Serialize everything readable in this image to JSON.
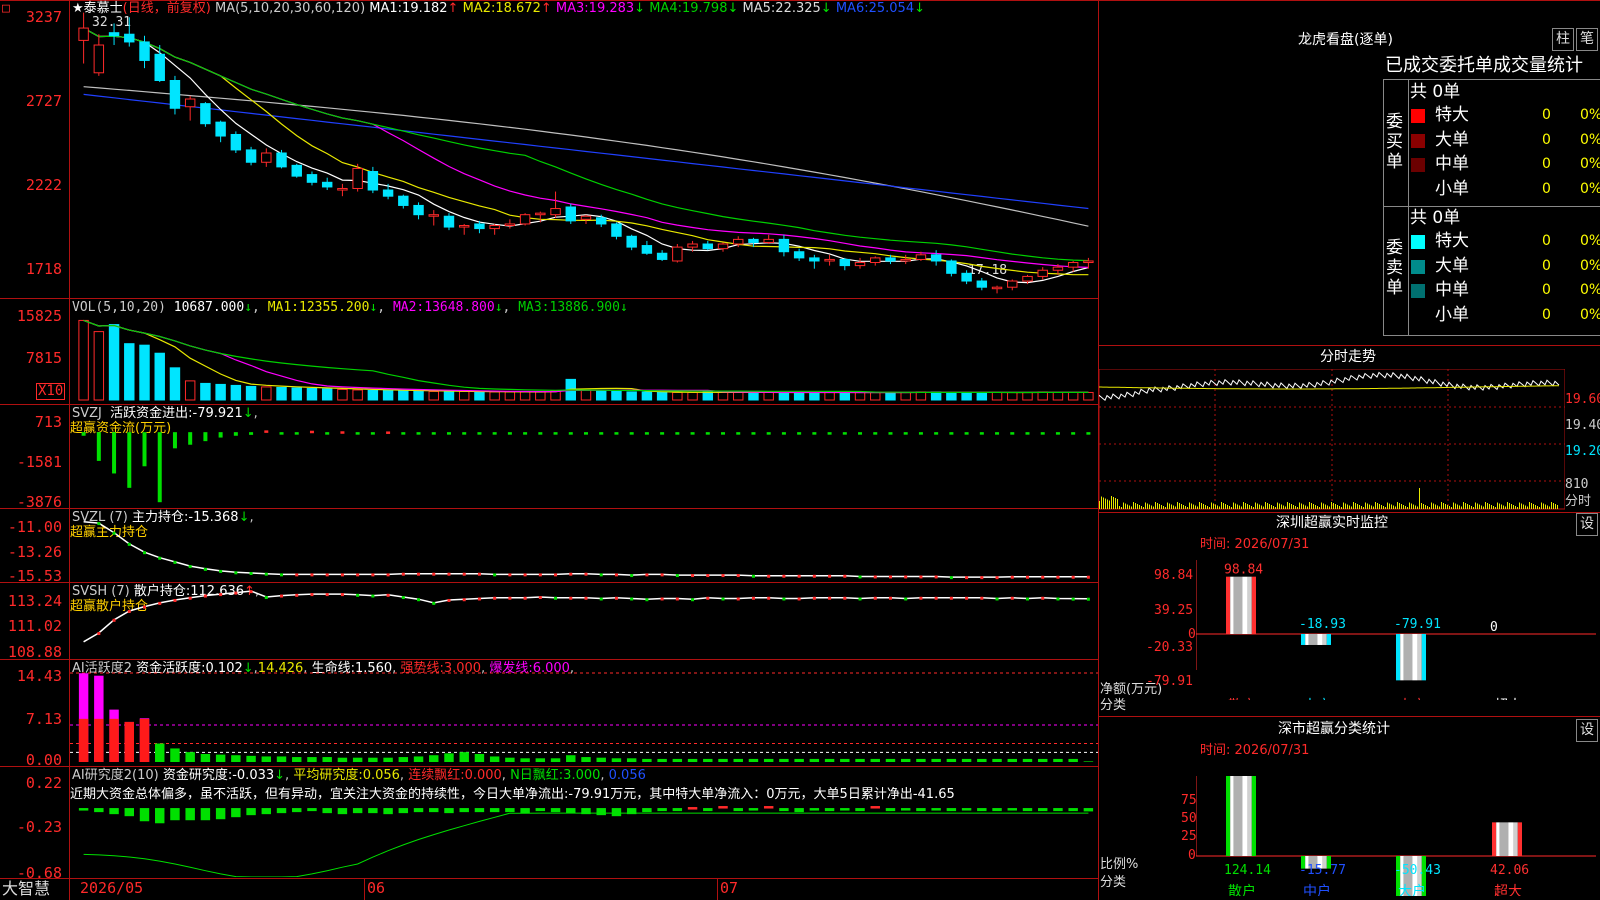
{
  "colors": {
    "up": "#ff2a2a",
    "down": "#00e5ff",
    "grid": "#b01010",
    "ma1": "#ffffff",
    "ma2": "#e8e800",
    "ma3": "#ff00ff",
    "ma4": "#00d000",
    "ma5": "#c0c0c0",
    "ma6": "#2040ff"
  },
  "main": {
    "stock_name": "泰慕士",
    "period": "(日线，前复权)",
    "ma_label": "MA(5,10,20,30,60,120)",
    "ma_values": [
      {
        "name": "MA1:",
        "value": "19.182",
        "arrow": "↑"
      },
      {
        "name": "MA2:",
        "value": "18.672",
        "arrow": "↑"
      },
      {
        "name": "MA3:",
        "value": "19.283",
        "arrow": "↓"
      },
      {
        "name": "MA4:",
        "value": "19.798",
        "arrow": "↓"
      },
      {
        "name": "MA5:",
        "value": "22.325",
        "arrow": "↓"
      },
      {
        "name": "MA6:",
        "value": "25.054",
        "arrow": "↓"
      }
    ],
    "y_ticks": [
      "3237",
      "2727",
      "2222",
      "1718"
    ],
    "high_label": "32.31",
    "low_label": "17.18",
    "corner_mark": "□"
  },
  "vol": {
    "label": "VOL(5,10,20)",
    "value": "10687.000",
    "arrow": "↓",
    "mas": [
      {
        "name": "MA1:",
        "value": "12355.200",
        "arrow": "↓"
      },
      {
        "name": "MA2:",
        "value": "13648.800",
        "arrow": "↓"
      },
      {
        "name": "MA3:",
        "value": "13886.900",
        "arrow": "↓"
      }
    ],
    "y_ticks": [
      "15825",
      "7815"
    ],
    "unit": "X10"
  },
  "svzj": {
    "label": "SVZJ",
    "name": "活跃资金进出:",
    "value": "-79.921",
    "arrow": "↓",
    "subtitle": "超赢资金流(万元)",
    "y_ticks": [
      "713",
      "-1581",
      "-3876"
    ]
  },
  "svzl": {
    "label": "SVZL (7)",
    "name": "主力持仓:",
    "value": "-15.368",
    "arrow": "↓",
    "subtitle": "超赢主力持仓",
    "y_ticks": [
      "-11.00",
      "-13.26",
      "-15.53"
    ]
  },
  "svsh": {
    "label": "SVSH (7)",
    "name": "散户持仓:",
    "value": "112.636",
    "arrow": "↑",
    "subtitle": "超赢散户持仓",
    "y_ticks": [
      "113.24",
      "111.02",
      "108.88"
    ]
  },
  "ai1": {
    "label": "AI活跃度2",
    "name": "资金活跃度:",
    "value": "0.102",
    "arrow": "↓",
    "v2": "14.426",
    "l3": "生命线:",
    "v3": "1.560",
    "l4": "强势线:",
    "v4": "3.000",
    "l5": "爆发线:",
    "v5": "6.000",
    "y_ticks": [
      "14.43",
      "7.13",
      "0.00"
    ]
  },
  "ai2": {
    "label": "AI研究度2(10)",
    "name": "资金研究度:",
    "value": "-0.033",
    "arrow": "↓",
    "l2": "平均研究度:",
    "v2": "0.056",
    "l3": "连续飘红:",
    "v3": "0.000",
    "l4": "N日飘红:",
    "v4": "3.000",
    "v5": "0.056",
    "comment": "近期大资金总体偏多，虽不活跃，但有异动，宜关注大资金的持续性，今日大单净流出:-79.91万元，其中特大单净流入：0万元，大单5日累计净出-41.65",
    "y_ticks": [
      "0.22",
      "-0.23",
      "-0.68"
    ]
  },
  "xaxis": {
    "brand": "大智慧",
    "labels": [
      "2026/05",
      "06",
      "07"
    ]
  },
  "lhb": {
    "title": "龙虎看盘(逐单)",
    "btn1": "柱",
    "btn2": "笔",
    "subtitle": "已成交委托单成交量统计",
    "buy": {
      "side": "委买单",
      "total": "共 0单",
      "rows": [
        {
          "name": "特大",
          "count": "0",
          "pct": "0%",
          "color": "#ff0000"
        },
        {
          "name": "大单",
          "count": "0",
          "pct": "0%",
          "color": "#8b0000"
        },
        {
          "name": "中单",
          "count": "0",
          "pct": "0%",
          "color": "#6b0000"
        },
        {
          "name": "小单",
          "count": "0",
          "pct": "0%",
          "color": ""
        }
      ]
    },
    "sell": {
      "side": "委卖单",
      "total": "共 0单",
      "rows": [
        {
          "name": "特大",
          "count": "0",
          "pct": "0%",
          "color": "#00ffff"
        },
        {
          "name": "大单",
          "count": "0",
          "pct": "0%",
          "color": "#008b8b"
        },
        {
          "name": "中单",
          "count": "0",
          "pct": "0%",
          "color": "#007070"
        },
        {
          "name": "小单",
          "count": "0",
          "pct": "0%",
          "color": ""
        }
      ]
    }
  },
  "intraday": {
    "title": "分时走势",
    "y_ticks": [
      "19.60",
      "19.40",
      "19.20"
    ],
    "vol_tick": "810",
    "label": "分时"
  },
  "monitor": {
    "title": "深圳超赢实时监控",
    "btn": "设",
    "time": "时间: 2026/07/31",
    "y_ticks": [
      "98.84",
      "39.25",
      "0",
      "-20.33",
      "-79.91"
    ],
    "ylabel": "净额(万元)",
    "xlabel": "分类",
    "bars": [
      {
        "cat": "散户",
        "value": 98.84,
        "label": "98.84"
      },
      {
        "cat": "中户",
        "value": -18.93,
        "label": "-18.93"
      },
      {
        "cat": "大户",
        "value": -79.91,
        "label": "-79.91"
      },
      {
        "cat": "超大",
        "value": 0,
        "label": "0"
      }
    ]
  },
  "stats": {
    "title": "深市超赢分类统计",
    "btn": "设",
    "time": "时间: 2026/07/31",
    "y_ticks": [
      "75",
      "50",
      "25",
      "0"
    ],
    "ylabel": "比例%",
    "xlabel": "分类",
    "bars": [
      {
        "cat": "散户",
        "value": 124.14,
        "label": "124.14"
      },
      {
        "cat": "中户",
        "value": -15.77,
        "label": "-15.77"
      },
      {
        "cat": "大户",
        "value": -50.43,
        "label": "-50.43"
      },
      {
        "cat": "超大",
        "value": 42.06,
        "label": "42.06"
      }
    ]
  },
  "chart_data": [
    {
      "type": "candlestick",
      "ylim": [
        17.18,
        32.31
      ],
      "y_ticks": [
        "3237",
        "2727",
        "2222",
        "1718"
      ],
      "ohlc": [
        [
          30.5,
          32.3,
          29.0,
          31.3
        ],
        [
          28.4,
          30.9,
          28.2,
          30.2
        ],
        [
          31.0,
          31.6,
          30.2,
          30.8
        ],
        [
          30.9,
          32.0,
          30.1,
          30.4
        ],
        [
          30.4,
          30.8,
          28.7,
          29.2
        ],
        [
          29.6,
          30.2,
          27.8,
          27.9
        ],
        [
          27.9,
          28.2,
          25.7,
          26.1
        ],
        [
          26.2,
          26.9,
          25.3,
          26.7
        ],
        [
          26.4,
          26.5,
          24.9,
          25.1
        ],
        [
          25.2,
          25.3,
          23.9,
          24.3
        ],
        [
          24.4,
          24.6,
          23.2,
          23.4
        ],
        [
          23.4,
          23.6,
          22.4,
          22.6
        ],
        [
          22.6,
          23.5,
          22.3,
          23.2
        ],
        [
          23.2,
          23.4,
          22.2,
          22.3
        ],
        [
          22.4,
          22.5,
          21.6,
          21.7
        ],
        [
          21.8,
          22.0,
          21.1,
          21.3
        ],
        [
          21.3,
          21.6,
          20.8,
          21.0
        ],
        [
          20.8,
          21.2,
          20.4,
          20.9
        ],
        [
          20.9,
          22.5,
          20.7,
          22.2
        ],
        [
          22.0,
          22.3,
          20.6,
          20.8
        ],
        [
          20.8,
          21.2,
          20.2,
          20.4
        ],
        [
          20.4,
          20.5,
          19.6,
          19.8
        ],
        [
          19.8,
          20.0,
          18.9,
          19.2
        ],
        [
          19.2,
          19.5,
          18.5,
          19.2
        ],
        [
          19.1,
          19.3,
          18.2,
          18.4
        ],
        [
          18.4,
          18.6,
          17.9,
          18.5
        ],
        [
          18.6,
          18.8,
          18.0,
          18.3
        ],
        [
          18.3,
          18.6,
          17.9,
          18.5
        ],
        [
          18.5,
          18.9,
          18.3,
          18.6
        ],
        [
          18.6,
          19.3,
          18.5,
          19.2
        ],
        [
          19.2,
          19.4,
          18.7,
          19.3
        ],
        [
          19.2,
          20.7,
          19.0,
          19.6
        ],
        [
          19.7,
          19.9,
          18.6,
          18.8
        ],
        [
          18.9,
          19.2,
          18.6,
          19.1
        ],
        [
          19.0,
          19.2,
          18.4,
          18.6
        ],
        [
          18.6,
          18.7,
          17.6,
          17.8
        ],
        [
          17.8,
          17.9,
          16.9,
          17.1
        ],
        [
          17.2,
          17.5,
          16.6,
          16.7
        ],
        [
          16.7,
          16.9,
          16.2,
          16.3
        ],
        [
          16.2,
          17.3,
          16.1,
          17.1
        ],
        [
          17.1,
          17.5,
          16.8,
          17.3
        ],
        [
          17.3,
          17.5,
          16.9,
          17.0
        ],
        [
          17.0,
          17.4,
          16.8,
          17.3
        ],
        [
          17.3,
          17.8,
          17.1,
          17.6
        ],
        [
          17.6,
          17.7,
          17.1,
          17.4
        ],
        [
          17.4,
          17.9,
          17.3,
          17.6
        ],
        [
          17.6,
          17.9,
          16.5,
          16.8
        ],
        [
          16.8,
          17.0,
          16.2,
          16.4
        ],
        [
          16.4,
          16.6,
          15.7,
          16.2
        ],
        [
          16.2,
          16.6,
          15.9,
          16.3
        ],
        [
          16.3,
          16.4,
          15.6,
          15.9
        ],
        [
          15.9,
          16.4,
          15.7,
          16.1
        ],
        [
          16.1,
          16.5,
          15.9,
          16.4
        ],
        [
          16.4,
          16.6,
          16.0,
          16.2
        ],
        [
          16.2,
          16.6,
          16.0,
          16.3
        ],
        [
          16.3,
          16.8,
          16.2,
          16.6
        ],
        [
          16.6,
          16.9,
          15.9,
          16.2
        ],
        [
          16.2,
          16.3,
          15.2,
          15.4
        ],
        [
          15.4,
          15.6,
          14.7,
          14.9
        ],
        [
          14.9,
          15.1,
          14.3,
          14.5
        ],
        [
          14.5,
          14.6,
          14.1,
          14.5
        ],
        [
          14.5,
          15.0,
          14.3,
          14.9
        ],
        [
          14.9,
          15.3,
          14.7,
          15.2
        ],
        [
          15.2,
          15.8,
          15.0,
          15.6
        ],
        [
          15.6,
          16.0,
          15.3,
          15.8
        ],
        [
          15.8,
          16.2,
          15.5,
          16.1
        ],
        [
          16.1,
          16.4,
          15.7,
          16.2
        ]
      ]
    },
    {
      "type": "bar",
      "name": "VOL",
      "ylim": [
        0,
        15825
      ],
      "values": [
        15825,
        13600,
        15000,
        11200,
        10900,
        9300,
        6400,
        3800,
        3300,
        3100,
        2900,
        2700,
        2600,
        2500,
        2400,
        2300,
        2200,
        2100,
        2000,
        1900,
        1900,
        1800,
        1800,
        1700,
        1700,
        1700,
        1600,
        1600,
        1600,
        1600,
        1600,
        1800,
        4100,
        2000,
        1900,
        1700,
        1600,
        1600,
        1500,
        1500,
        1500,
        1600,
        1500,
        1500,
        1500,
        1500,
        1500,
        1500,
        1500,
        1500,
        1500,
        1500,
        1500,
        1500,
        1500,
        1600,
        1600,
        1500,
        1500,
        1500,
        1500,
        1500,
        1500,
        1600,
        1500,
        1500,
        1500
      ]
    },
    {
      "type": "bar",
      "name": "SVZJ",
      "ylim": [
        -3876,
        713
      ],
      "values": [
        -200,
        -1600,
        -2300,
        -3100,
        -1900,
        -3900,
        -900,
        -700,
        -500,
        -300,
        -200,
        -150,
        100,
        -100,
        -80,
        80,
        -60,
        50,
        -90,
        -40,
        40,
        -70,
        -50,
        -60,
        -40,
        -80,
        -60,
        -70,
        -50,
        -60,
        -40,
        -60,
        -50,
        -40,
        -60,
        -70,
        -50,
        -40,
        -50,
        -60,
        -50,
        -60,
        -40,
        -60,
        -50,
        -60,
        -40,
        -50,
        -40,
        -60,
        -50,
        -40,
        -60,
        -50,
        -40,
        -60,
        -50,
        -40,
        -60,
        -50,
        -60,
        -50,
        -40,
        -60,
        -50,
        -40,
        -80
      ]
    },
    {
      "type": "line",
      "name": "SVZL",
      "ylim": [
        -15.53,
        -11.0
      ],
      "values": [
        -11.4,
        -11.5,
        -12.2,
        -13.0,
        -13.6,
        -14.0,
        -14.3,
        -14.6,
        -14.8,
        -14.95,
        -15.05,
        -15.1,
        -15.15,
        -15.2,
        -15.2,
        -15.2,
        -15.2,
        -15.2,
        -15.2,
        -15.2,
        -15.2,
        -15.15,
        -15.15,
        -15.15,
        -15.15,
        -15.15,
        -15.15,
        -15.2,
        -15.2,
        -15.2,
        -15.2,
        -15.2,
        -15.15,
        -15.15,
        -15.2,
        -15.2,
        -15.25,
        -15.2,
        -15.2,
        -15.25,
        -15.25,
        -15.25,
        -15.25,
        -15.25,
        -15.3,
        -15.3,
        -15.3,
        -15.3,
        -15.3,
        -15.3,
        -15.3,
        -15.35,
        -15.35,
        -15.35,
        -15.35,
        -15.35,
        -15.35,
        -15.4,
        -15.4,
        -15.4,
        -15.4,
        -15.37,
        -15.37,
        -15.37,
        -15.37,
        -15.37,
        -15.368
      ]
    },
    {
      "type": "line",
      "name": "SVSH",
      "ylim": [
        108.88,
        113.24
      ],
      "values": [
        109.7,
        110.3,
        111.2,
        111.8,
        112.1,
        112.35,
        112.55,
        112.7,
        112.85,
        112.95,
        113.05,
        113.15,
        112.75,
        112.85,
        112.9,
        112.95,
        112.95,
        112.95,
        112.9,
        112.85,
        112.9,
        112.75,
        112.6,
        112.35,
        112.55,
        112.6,
        112.65,
        112.7,
        112.7,
        112.7,
        112.75,
        112.7,
        112.7,
        112.7,
        112.65,
        112.7,
        112.65,
        112.6,
        112.65,
        112.65,
        112.6,
        112.7,
        112.65,
        112.65,
        112.7,
        112.7,
        112.65,
        112.65,
        112.7,
        112.7,
        112.7,
        112.65,
        112.7,
        112.7,
        112.65,
        112.7,
        112.7,
        112.7,
        112.7,
        112.7,
        112.65,
        112.7,
        112.65,
        112.7,
        112.65,
        112.64,
        112.636
      ]
    },
    {
      "type": "bar",
      "name": "AI活跃度2",
      "ylim": [
        0,
        14.43
      ],
      "values": [
        14.4,
        14.0,
        8.5,
        6.5,
        7.1,
        3.0,
        2.2,
        1.6,
        1.3,
        1.2,
        1.1,
        1.0,
        0.9,
        0.9,
        0.8,
        0.8,
        0.8,
        0.7,
        0.7,
        0.7,
        0.7,
        0.8,
        0.9,
        1.1,
        1.4,
        1.6,
        1.3,
        0.9,
        0.7,
        0.6,
        0.6,
        0.6,
        1.1,
        0.8,
        0.7,
        0.6,
        0.6,
        0.5,
        0.5,
        0.5,
        0.5,
        0.5,
        0.5,
        0.5,
        0.5,
        0.5,
        0.5,
        0.5,
        0.5,
        0.5,
        0.5,
        0.5,
        0.5,
        0.5,
        0.5,
        0.5,
        0.5,
        0.5,
        0.5,
        0.5,
        0.5,
        0.5,
        0.5,
        0.5,
        0.5,
        0.5,
        0.102
      ]
    },
    {
      "type": "bar",
      "name": "AI研究度2",
      "ylim": [
        -0.68,
        0.22
      ],
      "values": [
        -0.02,
        -0.04,
        -0.06,
        -0.08,
        -0.13,
        -0.15,
        -0.12,
        -0.12,
        -0.12,
        -0.11,
        -0.09,
        -0.07,
        -0.06,
        -0.05,
        -0.04,
        -0.03,
        -0.05,
        -0.06,
        -0.05,
        -0.05,
        -0.06,
        -0.05,
        -0.04,
        -0.04,
        -0.05,
        -0.04,
        -0.04,
        -0.04,
        -0.04,
        -0.05,
        -0.03,
        -0.04,
        -0.05,
        -0.06,
        -0.07,
        -0.08,
        -0.06,
        -0.04,
        -0.03,
        -0.03,
        0.01,
        -0.03,
        0.02,
        -0.03,
        -0.02,
        0.02,
        -0.03,
        -0.04,
        -0.02,
        -0.03,
        -0.02,
        -0.03,
        0.02,
        -0.03,
        -0.02,
        -0.03,
        -0.02,
        -0.03,
        -0.02,
        -0.03,
        -0.03,
        -0.02,
        -0.03,
        -0.03,
        -0.03,
        -0.03,
        -0.033
      ]
    }
  ]
}
